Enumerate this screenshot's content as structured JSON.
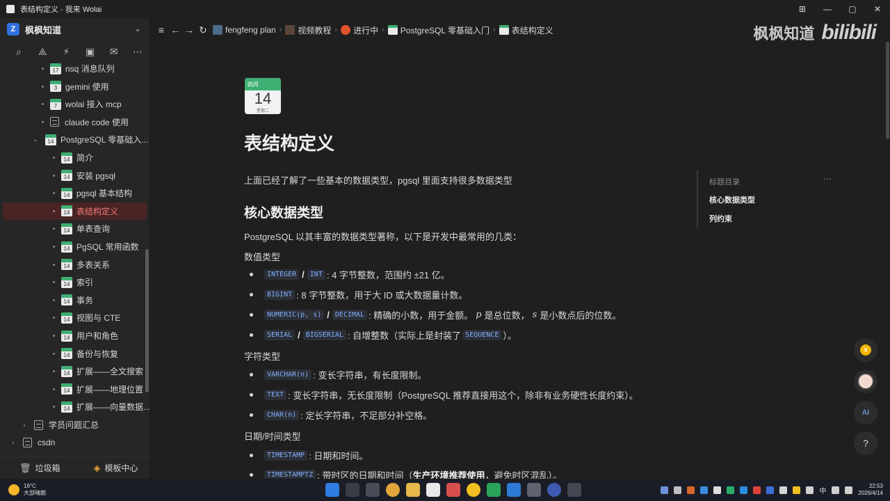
{
  "window": {
    "title": "表结构定义 - 我来 Wolai"
  },
  "window_controls": [
    "⊞",
    "—",
    "▢",
    "✕"
  ],
  "workspace": {
    "logo": "Z",
    "name": "枫枫知道"
  },
  "sidebar_tree": [
    {
      "label": "nsq 消息队列",
      "cal": "17",
      "depth": 1,
      "icon": "cal"
    },
    {
      "label": "gemini 使用",
      "cal": "3",
      "depth": 1,
      "icon": "cal"
    },
    {
      "label": "wolai 接入 mcp",
      "cal": "7",
      "depth": 1,
      "icon": "cal"
    },
    {
      "label": "claude code 使用",
      "depth": 1,
      "icon": "doc"
    },
    {
      "label": "PostgreSQL 零基础入...",
      "cal": "14",
      "depth": 1,
      "icon": "cal",
      "expanded": true
    },
    {
      "label": "简介",
      "cal": "14",
      "depth": 2,
      "icon": "cal"
    },
    {
      "label": "安装 pgsql",
      "cal": "14",
      "depth": 2,
      "icon": "cal"
    },
    {
      "label": "pgsql 基本结构",
      "cal": "14",
      "depth": 2,
      "icon": "cal"
    },
    {
      "label": "表结构定义",
      "cal": "14",
      "depth": 2,
      "icon": "cal",
      "active": true
    },
    {
      "label": "单表查询",
      "cal": "14",
      "depth": 2,
      "icon": "cal"
    },
    {
      "label": "PgSQL 常用函数",
      "cal": "14",
      "depth": 2,
      "icon": "cal"
    },
    {
      "label": "多表关系",
      "cal": "14",
      "depth": 2,
      "icon": "cal"
    },
    {
      "label": "索引",
      "cal": "14",
      "depth": 2,
      "icon": "cal"
    },
    {
      "label": "事务",
      "cal": "14",
      "depth": 2,
      "icon": "cal"
    },
    {
      "label": "视图与 CTE",
      "cal": "14",
      "depth": 2,
      "icon": "cal"
    },
    {
      "label": "用户和角色",
      "cal": "14",
      "depth": 2,
      "icon": "cal"
    },
    {
      "label": "备份与恢复",
      "cal": "14",
      "depth": 2,
      "icon": "cal"
    },
    {
      "label": "扩展——全文搜索",
      "cal": "14",
      "depth": 2,
      "icon": "cal"
    },
    {
      "label": "扩展——地理位置",
      "cal": "14",
      "depth": 2,
      "icon": "cal"
    },
    {
      "label": "扩展——向量数据...",
      "cal": "14",
      "depth": 2,
      "icon": "cal"
    },
    {
      "label": "学员问题汇总",
      "depth": 0,
      "icon": "doc",
      "caret": "›"
    },
    {
      "label": "csdn",
      "depth": -1,
      "icon": "doc",
      "caret": "›"
    }
  ],
  "sidebar_footer": {
    "trash": "垃圾箱",
    "templates": "模板中心"
  },
  "breadcrumb": [
    "fengfeng plan",
    "视频教程",
    "进行中",
    "PostgreSQL 零基础入门",
    "表结构定义"
  ],
  "watermark": {
    "text": "枫枫知道",
    "logo": "bilibili"
  },
  "page": {
    "cal_month": "四月",
    "cal_day": "14",
    "cal_week": "星期二",
    "title": "表结构定义",
    "intro": "上面已经了解了一些基本的数据类型，pgsql 里面支持很多数据类型",
    "h2": "核心数据类型",
    "p2": "PostgreSQL 以其丰富的数据类型著称，以下是开发中最常用的几类：",
    "section_numeric": "数值类型",
    "section_string": "字符类型",
    "section_datetime": "日期/时间类型",
    "numeric": [
      {
        "codes": [
          "INTEGER",
          "INT"
        ],
        "text": ": 4 字节整数，范围约 ±21 亿。"
      },
      {
        "codes": [
          "BIGINT"
        ],
        "text": ": 8 字节整数，用于大 ID 或大数据量计数。"
      },
      {
        "codes": [
          "NUMERIC(p, s)",
          "DECIMAL"
        ],
        "text": ": 精确的小数，用于金额。",
        "m1": "p",
        "t1": "是总位数，",
        "m2": "s",
        "t2": "是小数点后的位数。"
      },
      {
        "codes": [
          "SERIAL",
          "BIGSERIAL"
        ],
        "text": ": 自增整数（实际上是封装了",
        "code_inline": "SEQUENCE",
        "tail": "）。"
      }
    ],
    "string": [
      {
        "code": "VARCHAR(n)",
        "text": ": 变长字符串，有长度限制。"
      },
      {
        "code": "TEXT",
        "text": ": 变长字符串，无长度限制（PostgreSQL 推荐直接用这个，除非有业务硬性长度约束）。"
      },
      {
        "code": "CHAR(n)",
        "text": ": 定长字符串，不足部分补空格。"
      }
    ],
    "datetime": [
      {
        "code": "TIMESTAMP",
        "text": ": 日期和时间。"
      },
      {
        "code": "TIMESTAMPTZ",
        "text": ": 带时区的日期和时间（",
        "bold": "生产环境推荐使用",
        "tail": "，避免时区混乱）。"
      }
    ]
  },
  "outline": {
    "title": "标题目录",
    "items": [
      "核心数据类型",
      "列约束"
    ]
  },
  "taskbar": {
    "weather_temp": "16°C",
    "weather_desc": "大部晴朗",
    "time": "22:53",
    "date": "2026/4/14",
    "ime": "中"
  },
  "colors": {
    "accent": "#3fae73",
    "active_bg": "#4a2424",
    "active_text": "#f07a7a",
    "code": "#7fb0ff"
  }
}
